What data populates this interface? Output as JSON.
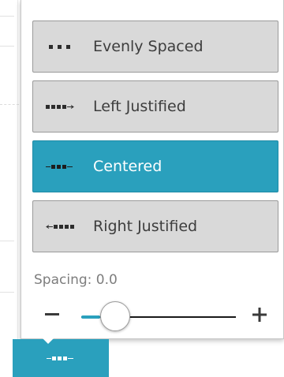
{
  "alignment_options": [
    {
      "label": "Evenly Spaced",
      "icon": "evenly-spaced-icon",
      "selected": false
    },
    {
      "label": "Left Justified",
      "icon": "left-justified-icon",
      "selected": false
    },
    {
      "label": "Centered",
      "icon": "centered-icon",
      "selected": true
    },
    {
      "label": "Right Justified",
      "icon": "right-justified-icon",
      "selected": false
    }
  ],
  "spacing": {
    "label": "Spacing: 0.0",
    "value": 0.0,
    "slider_fraction": 0.22,
    "minus_symbol": "−",
    "plus_symbol": "+"
  },
  "toolbar": {
    "button_icon": "centered-icon"
  },
  "colors": {
    "accent": "#2aa0bd",
    "option_bg": "#d9d9d9",
    "option_border": "#9a9a9a",
    "text": "#3d3d3d",
    "muted": "#7d7d7d"
  }
}
